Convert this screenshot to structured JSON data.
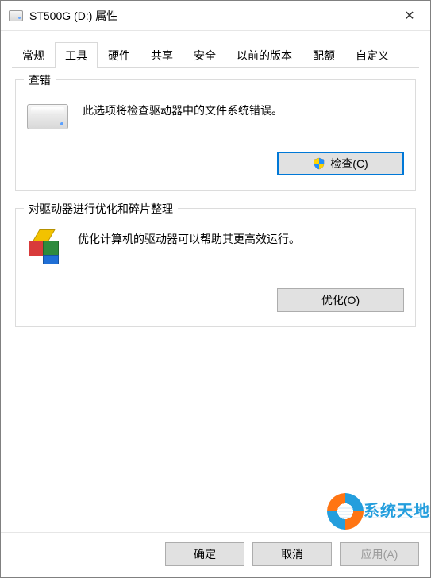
{
  "window": {
    "title": "ST500G (D:) 属性",
    "close_glyph": "✕"
  },
  "tabs": [
    {
      "label": "常规"
    },
    {
      "label": "工具"
    },
    {
      "label": "硬件"
    },
    {
      "label": "共享"
    },
    {
      "label": "安全"
    },
    {
      "label": "以前的版本"
    },
    {
      "label": "配额"
    },
    {
      "label": "自定义"
    }
  ],
  "active_tab_index": 1,
  "group_check": {
    "legend": "查错",
    "desc": "此选项将检查驱动器中的文件系统错误。",
    "button": "检查(C)"
  },
  "group_defrag": {
    "legend": "对驱动器进行优化和碎片整理",
    "desc": "优化计算机的驱动器可以帮助其更高效运行。",
    "button": "优化(O)"
  },
  "footer": {
    "ok": "确定",
    "cancel": "取消",
    "apply": "应用(A)"
  },
  "watermark": {
    "text": "系统天地"
  }
}
